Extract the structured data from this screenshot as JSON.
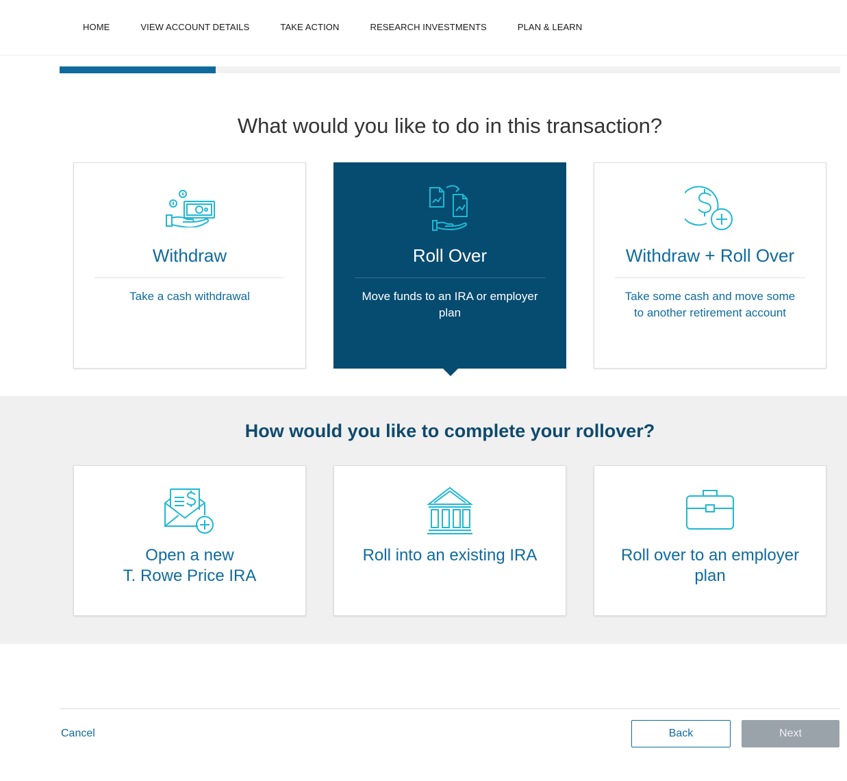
{
  "nav": {
    "items": [
      {
        "label": "HOME"
      },
      {
        "label": "VIEW ACCOUNT DETAILS"
      },
      {
        "label": "TAKE ACTION"
      },
      {
        "label": "RESEARCH INVESTMENTS"
      },
      {
        "label": "PLAN & LEARN"
      }
    ]
  },
  "progress": {
    "fraction": 0.2
  },
  "transaction": {
    "question": "What would you like to do in this transaction?",
    "options": [
      {
        "title": "Withdraw",
        "description": "Take a cash withdrawal",
        "icon": "cash-hand-icon",
        "selected": false
      },
      {
        "title": "Roll Over",
        "description": "Move funds to an IRA or employer plan",
        "icon": "documents-transfer-icon",
        "selected": true
      },
      {
        "title": "Withdraw + Roll Over",
        "description": "Take some cash and move some to another retirement account",
        "icon": "dollar-plus-icon",
        "selected": false
      }
    ]
  },
  "rollover": {
    "question": "How would you like to complete your rollover?",
    "options": [
      {
        "title_line1": "Open a new",
        "title_line2": "T. Rowe Price IRA",
        "icon": "envelope-dollar-plus-icon"
      },
      {
        "title": "Roll into an existing IRA",
        "icon": "bank-icon"
      },
      {
        "title_line1": "Roll over to an employer",
        "title_line2": "plan",
        "icon": "briefcase-icon"
      }
    ]
  },
  "footer": {
    "cancel_label": "Cancel",
    "back_label": "Back",
    "next_label": "Next"
  },
  "colors": {
    "brand_blue": "#0f6b9e",
    "selected_bg": "#064b70",
    "icon_cyan": "#1fb8d4",
    "disabled_gray": "#9aa2aa"
  }
}
